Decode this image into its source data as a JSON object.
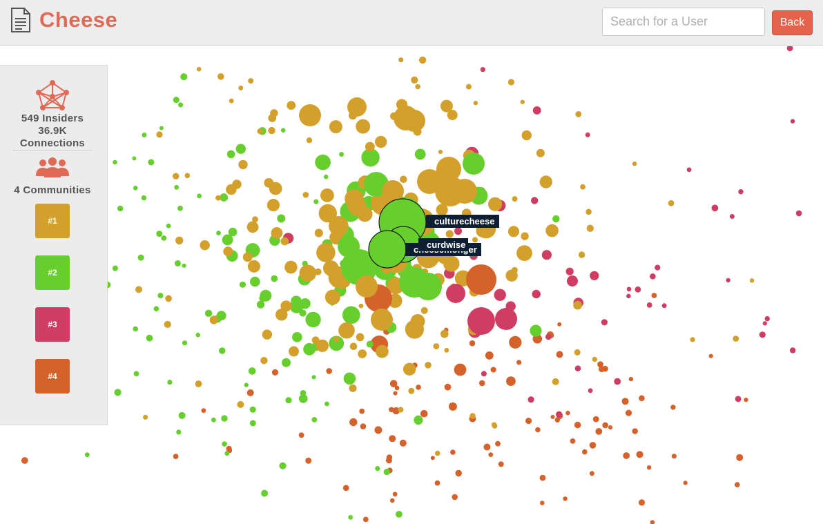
{
  "header": {
    "title": "Cheese",
    "search_placeholder": "Search for a User",
    "back_label": "Back",
    "title_color": "#e06a55",
    "icon": "document-icon"
  },
  "sidebar": {
    "insiders": "549 Insiders",
    "connections_value": "36.9K",
    "connections_label": "Connections",
    "communities": "4 Communities",
    "network_icon": "network-icon",
    "people_icon": "people-icon",
    "community_buttons": [
      {
        "label": "#1",
        "color": "#d4a02c"
      },
      {
        "label": "#2",
        "color": "#66cf2e"
      },
      {
        "label": "#3",
        "color": "#d03d63"
      },
      {
        "label": "#4",
        "color": "#d5622a"
      }
    ]
  },
  "graph": {
    "community_colors": [
      "#d4a02c",
      "#66cf2e",
      "#d03d63",
      "#d5622a"
    ],
    "highlighted_users": [
      "culturecheese",
      "cheesemonger",
      "curdwise"
    ]
  }
}
